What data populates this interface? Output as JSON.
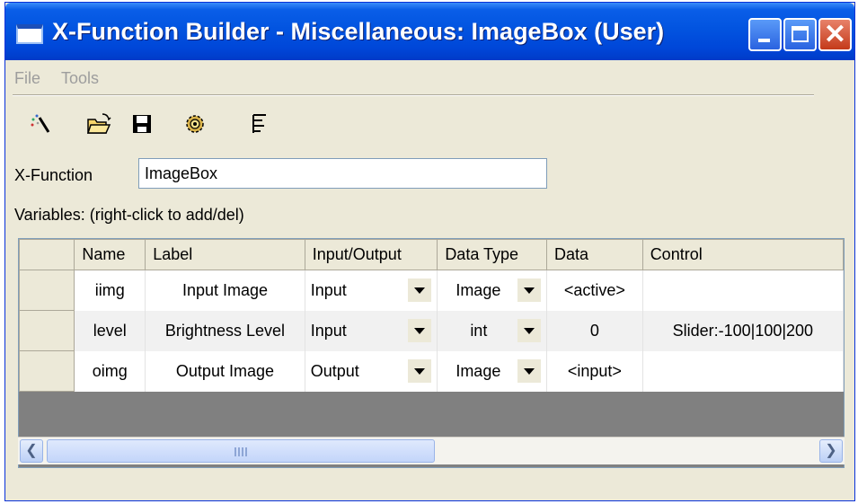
{
  "window": {
    "title": "X-Function Builder - Miscellaneous: ImageBox (User)"
  },
  "menu": {
    "items": [
      "File",
      "Tools"
    ]
  },
  "toolbar": {
    "icons": [
      "new-wizard-icon",
      "open-folder-icon",
      "save-disk-icon",
      "compile-gear-icon",
      "tree-view-icon"
    ]
  },
  "xfunction": {
    "label": "X-Function",
    "value": "ImageBox"
  },
  "variables": {
    "label": "Variables: (right-click to add/del)"
  },
  "table": {
    "headers": [
      "Name",
      "Label",
      "Input/Output",
      "Data Type",
      "Data",
      "Control"
    ],
    "rows": [
      [
        "iimg",
        "Input Image",
        "Input",
        "Image",
        "<active>",
        ""
      ],
      [
        "level",
        "Brightness Level",
        "Input",
        "int",
        "0",
        "Slider:-100|100|200"
      ],
      [
        "oimg",
        "Output Image",
        "Output",
        "Image",
        "<input>",
        ""
      ]
    ]
  },
  "colors": {
    "titlebar": "#0254e0",
    "window_bg": "#ece9d8",
    "grid_empty": "#808080"
  }
}
